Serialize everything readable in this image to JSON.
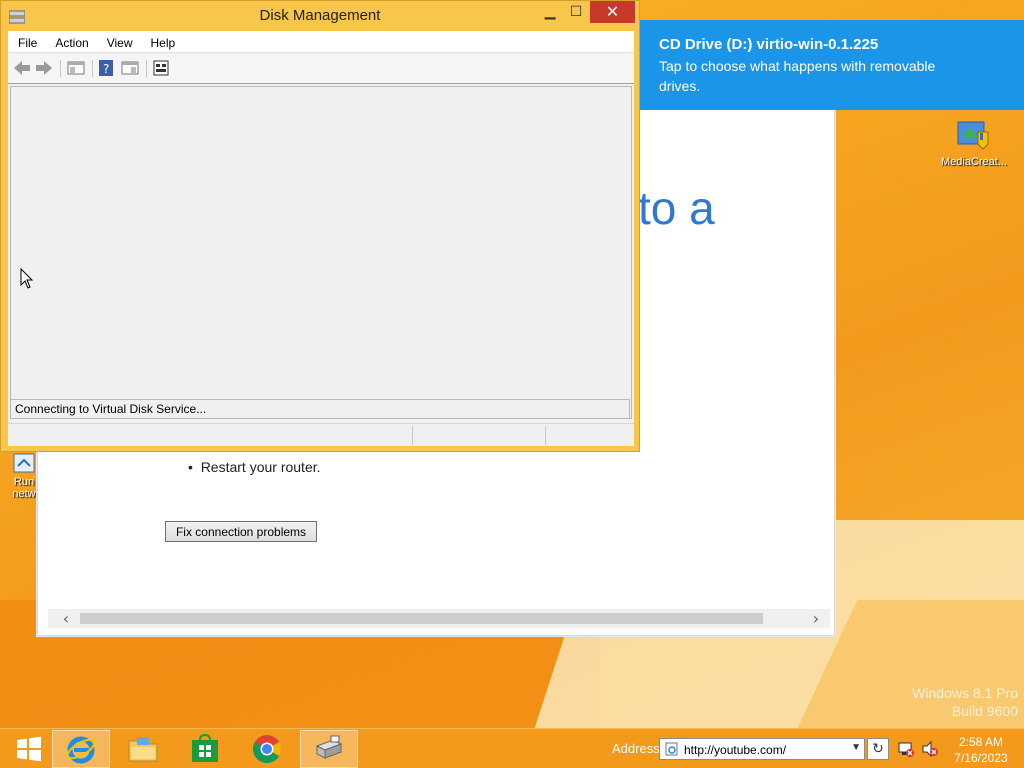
{
  "desktop": {
    "watermark_line1": "Windows 8.1 Pro",
    "watermark_line2": "Build 9600",
    "icons": [
      {
        "label": "MediaCreat...",
        "icon": "media-creation-tool-icon"
      },
      {
        "label": "Run",
        "label2": "netw",
        "icon": "run-network-icon"
      }
    ]
  },
  "background_window": {
    "big_text": "to a",
    "bullet_text": "Restart your router.",
    "fix_button": "Fix connection problems"
  },
  "toast": {
    "title": "CD Drive (D:) virtio-win-0.1.225",
    "message": "Tap to choose what happens with removable drives.",
    "color": "#1a95e8"
  },
  "disk_management": {
    "title": "Disk Management",
    "menu": [
      "File",
      "Action",
      "View",
      "Help"
    ],
    "status_text": "Connecting to Virtual Disk Service...",
    "toolbar_icons": [
      "back-arrow-icon",
      "forward-arrow-icon",
      "show-hide-console-tree-icon",
      "help-icon",
      "properties-icon",
      "disk-settings-icon"
    ]
  },
  "taskbar": {
    "address_label": "Address",
    "address_value": "http://youtube.com/",
    "time": "2:58 AM",
    "date": "7/16/2023",
    "apps": [
      "start-icon",
      "internet-explorer-icon",
      "file-explorer-icon",
      "store-icon",
      "chrome-icon",
      "disk-management-icon"
    ],
    "accent": "#f39a1c"
  }
}
